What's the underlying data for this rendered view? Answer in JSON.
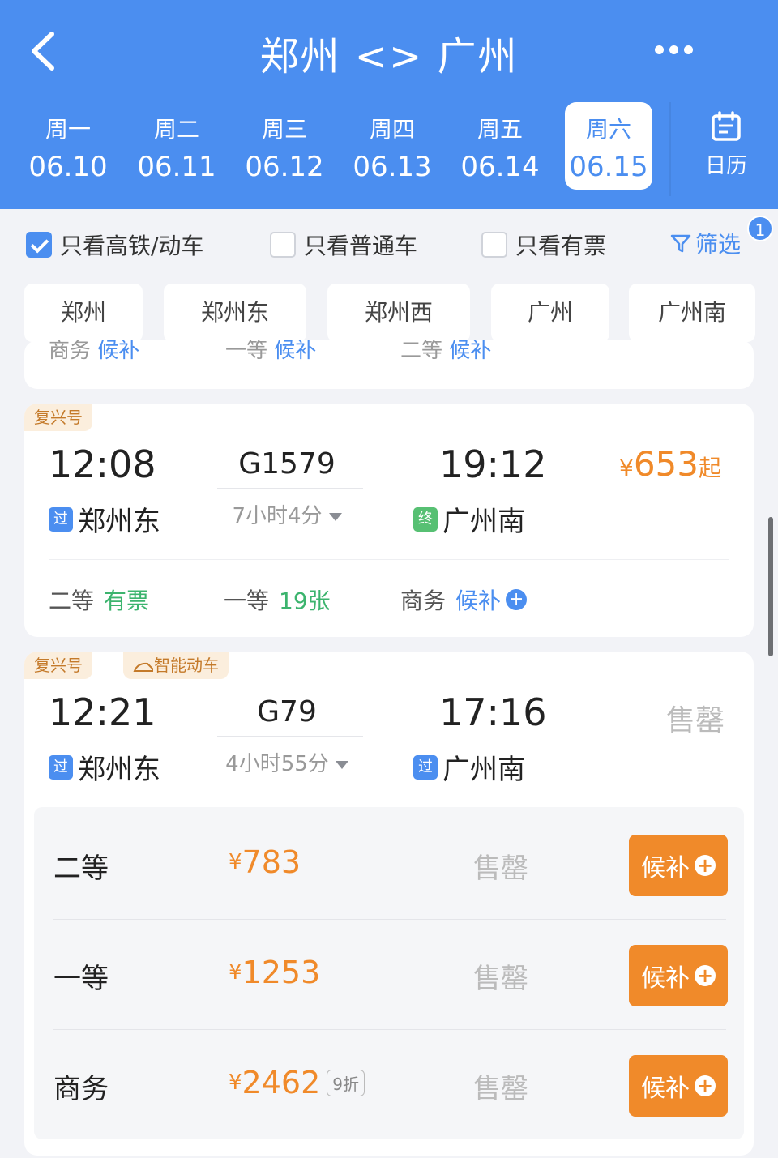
{
  "header": {
    "title": "郑州 <> 广州",
    "days": [
      {
        "weekday": "周一",
        "date": "06.10"
      },
      {
        "weekday": "周二",
        "date": "06.11"
      },
      {
        "weekday": "周三",
        "date": "06.12"
      },
      {
        "weekday": "周四",
        "date": "06.13"
      },
      {
        "weekday": "周五",
        "date": "06.14"
      },
      {
        "weekday": "周六",
        "date": "06.15"
      }
    ],
    "active_day_index": 5,
    "calendar_label": "日历"
  },
  "filters": {
    "high_speed_only": "只看高铁/动车",
    "normal_only": "只看普通车",
    "available_only": "只看有票",
    "screen_label": "筛选",
    "screen_badge": "1"
  },
  "stations": [
    "郑州",
    "郑州东",
    "郑州西",
    "广州",
    "广州南"
  ],
  "peek_card": {
    "items": [
      {
        "class": "商务",
        "status": "候补"
      },
      {
        "class": "一等",
        "status": "候补"
      },
      {
        "class": "二等",
        "status": "候补"
      }
    ]
  },
  "trains": [
    {
      "tags": [
        "复兴号"
      ],
      "depart_time": "12:08",
      "depart_mark": "过",
      "depart_station": "郑州东",
      "train_no": "G1579",
      "duration": "7小时4分",
      "arrive_time": "19:12",
      "arrive_mark": "终",
      "arrive_station": "广州南",
      "price_symbol": "¥",
      "price": "653",
      "price_suffix": "起",
      "seats": [
        {
          "class": "二等",
          "status": "有票"
        },
        {
          "class": "一等",
          "status": "19张"
        },
        {
          "class": "商务",
          "status": "候补"
        }
      ]
    },
    {
      "tags": [
        "复兴号",
        "智能动车"
      ],
      "depart_time": "12:21",
      "depart_mark": "过",
      "depart_station": "郑州东",
      "train_no": "G79",
      "duration": "4小时55分",
      "arrive_time": "17:16",
      "arrive_mark": "过",
      "arrive_station": "广州南",
      "status_top": "售罄",
      "rows": [
        {
          "class": "二等",
          "price": "783",
          "status": "售罄",
          "button": "候补"
        },
        {
          "class": "一等",
          "price": "1253",
          "status": "售罄",
          "button": "候补"
        },
        {
          "class": "商务",
          "price": "2462",
          "discount": "9折",
          "status": "售罄",
          "button": "候补"
        }
      ]
    }
  ],
  "colors": {
    "primary": "#4b8ef0",
    "orange": "#f08a2a",
    "green": "#3cb46e"
  }
}
